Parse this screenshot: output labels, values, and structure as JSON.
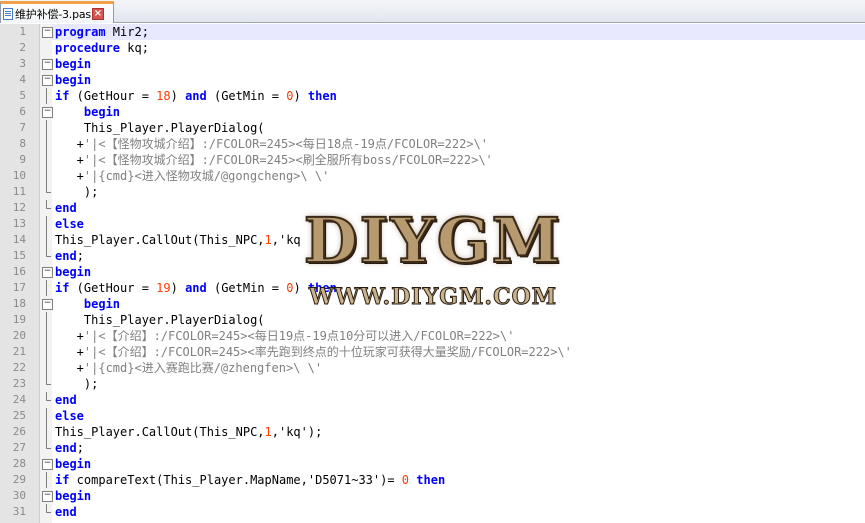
{
  "tab": {
    "label": "维护补偿-3.pas",
    "file_icon": "document-icon",
    "close_icon": "close-icon"
  },
  "editor": {
    "current_line": 1,
    "lines": [
      {
        "n": "1",
        "fold": "box",
        "tokens": [
          [
            "kw",
            "program"
          ],
          [
            "t",
            " Mir2;"
          ]
        ]
      },
      {
        "n": "2",
        "fold": "",
        "tokens": [
          [
            "kw",
            "procedure"
          ],
          [
            "t",
            " kq;"
          ]
        ]
      },
      {
        "n": "3",
        "fold": "box",
        "tokens": [
          [
            "kw",
            "begin"
          ]
        ]
      },
      {
        "n": "4",
        "fold": "box",
        "tokens": [
          [
            "kw",
            "begin"
          ]
        ]
      },
      {
        "n": "5",
        "fold": "vline",
        "tokens": [
          [
            "kw",
            "if"
          ],
          [
            "t",
            " (GetHour = "
          ],
          [
            "num",
            "18"
          ],
          [
            "t",
            ") "
          ],
          [
            "kw",
            "and"
          ],
          [
            "t",
            " (GetMin = "
          ],
          [
            "num",
            "0"
          ],
          [
            "t",
            ") "
          ],
          [
            "kw",
            "then"
          ]
        ]
      },
      {
        "n": "6",
        "fold": "box",
        "tokens": [
          [
            "t",
            "    "
          ],
          [
            "kw",
            "begin"
          ]
        ]
      },
      {
        "n": "7",
        "fold": "vline",
        "tokens": [
          [
            "t",
            "    This_Player.PlayerDialog("
          ]
        ]
      },
      {
        "n": "8",
        "fold": "vline",
        "tokens": [
          [
            "t",
            "   +"
          ],
          [
            "str",
            "'|<【怪物攻城介绍】:/FCOLOR=245><每日18点-19点/FCOLOR=222>\\'"
          ]
        ]
      },
      {
        "n": "9",
        "fold": "vline",
        "tokens": [
          [
            "t",
            "   +"
          ],
          [
            "str",
            "'|<【怪物攻城介绍】:/FCOLOR=245><刷全服所有boss/FCOLOR=222>\\'"
          ]
        ]
      },
      {
        "n": "10",
        "fold": "vline",
        "tokens": [
          [
            "t",
            "   +"
          ],
          [
            "str",
            "'|{cmd}<进入怪物攻城/@gongcheng>\\ \\'"
          ]
        ]
      },
      {
        "n": "11",
        "fold": "end",
        "tokens": [
          [
            "t",
            "    );"
          ]
        ]
      },
      {
        "n": "12",
        "fold": "end",
        "tokens": [
          [
            "kw",
            "end"
          ]
        ]
      },
      {
        "n": "13",
        "fold": "vline",
        "tokens": [
          [
            "kw",
            "else"
          ]
        ]
      },
      {
        "n": "14",
        "fold": "vline",
        "tokens": [
          [
            "t",
            "This_Player.CallOut(This_NPC,"
          ],
          [
            "num",
            "1"
          ],
          [
            "t",
            ",'kq"
          ]
        ]
      },
      {
        "n": "15",
        "fold": "end",
        "tokens": [
          [
            "kw",
            "end"
          ],
          [
            "t",
            ";"
          ]
        ]
      },
      {
        "n": "16",
        "fold": "box",
        "tokens": [
          [
            "kw",
            "begin"
          ]
        ]
      },
      {
        "n": "17",
        "fold": "vline",
        "tokens": [
          [
            "kw",
            "if"
          ],
          [
            "t",
            " (GetHour = "
          ],
          [
            "num",
            "19"
          ],
          [
            "t",
            ") "
          ],
          [
            "kw",
            "and"
          ],
          [
            "t",
            " (GetMin = "
          ],
          [
            "num",
            "0"
          ],
          [
            "t",
            ") "
          ],
          [
            "kw",
            "then"
          ]
        ]
      },
      {
        "n": "18",
        "fold": "box",
        "tokens": [
          [
            "t",
            "    "
          ],
          [
            "kw",
            "begin"
          ]
        ]
      },
      {
        "n": "19",
        "fold": "vline",
        "tokens": [
          [
            "t",
            "    This_Player.PlayerDialog("
          ]
        ]
      },
      {
        "n": "20",
        "fold": "vline",
        "tokens": [
          [
            "t",
            "   +"
          ],
          [
            "str",
            "'|<【介绍】:/FCOLOR=245><每日19点-19点10分可以进入/FCOLOR=222>\\'"
          ]
        ]
      },
      {
        "n": "21",
        "fold": "vline",
        "tokens": [
          [
            "t",
            "   +"
          ],
          [
            "str",
            "'|<【介绍】:/FCOLOR=245><率先跑到终点的十位玩家可获得大量奖励/FCOLOR=222>\\'"
          ]
        ]
      },
      {
        "n": "22",
        "fold": "vline",
        "tokens": [
          [
            "t",
            "   +"
          ],
          [
            "str",
            "'|{cmd}<进入赛跑比赛/@zhengfen>\\ \\'"
          ]
        ]
      },
      {
        "n": "23",
        "fold": "end",
        "tokens": [
          [
            "t",
            "    );"
          ]
        ]
      },
      {
        "n": "24",
        "fold": "end",
        "tokens": [
          [
            "kw",
            "end"
          ]
        ]
      },
      {
        "n": "25",
        "fold": "vline",
        "tokens": [
          [
            "kw",
            "else"
          ]
        ]
      },
      {
        "n": "26",
        "fold": "vline",
        "tokens": [
          [
            "t",
            "This_Player.CallOut(This_NPC,"
          ],
          [
            "num",
            "1"
          ],
          [
            "t",
            ",'kq');"
          ]
        ]
      },
      {
        "n": "27",
        "fold": "end",
        "tokens": [
          [
            "kw",
            "end"
          ],
          [
            "t",
            ";"
          ]
        ]
      },
      {
        "n": "28",
        "fold": "box",
        "tokens": [
          [
            "kw",
            "begin"
          ]
        ]
      },
      {
        "n": "29",
        "fold": "vline",
        "tokens": [
          [
            "kw",
            "if"
          ],
          [
            "t",
            " compareText(This_Player.MapName,'D5071~33')= "
          ],
          [
            "num",
            "0"
          ],
          [
            "t",
            " "
          ],
          [
            "kw",
            "then"
          ]
        ]
      },
      {
        "n": "30",
        "fold": "box",
        "tokens": [
          [
            "kw",
            "begin"
          ]
        ]
      },
      {
        "n": "31",
        "fold": "end",
        "tokens": [
          [
            "kw",
            "end"
          ]
        ]
      }
    ]
  },
  "watermark": {
    "logo": "DIYGM",
    "url": "WWW.DIYGM.COM"
  }
}
